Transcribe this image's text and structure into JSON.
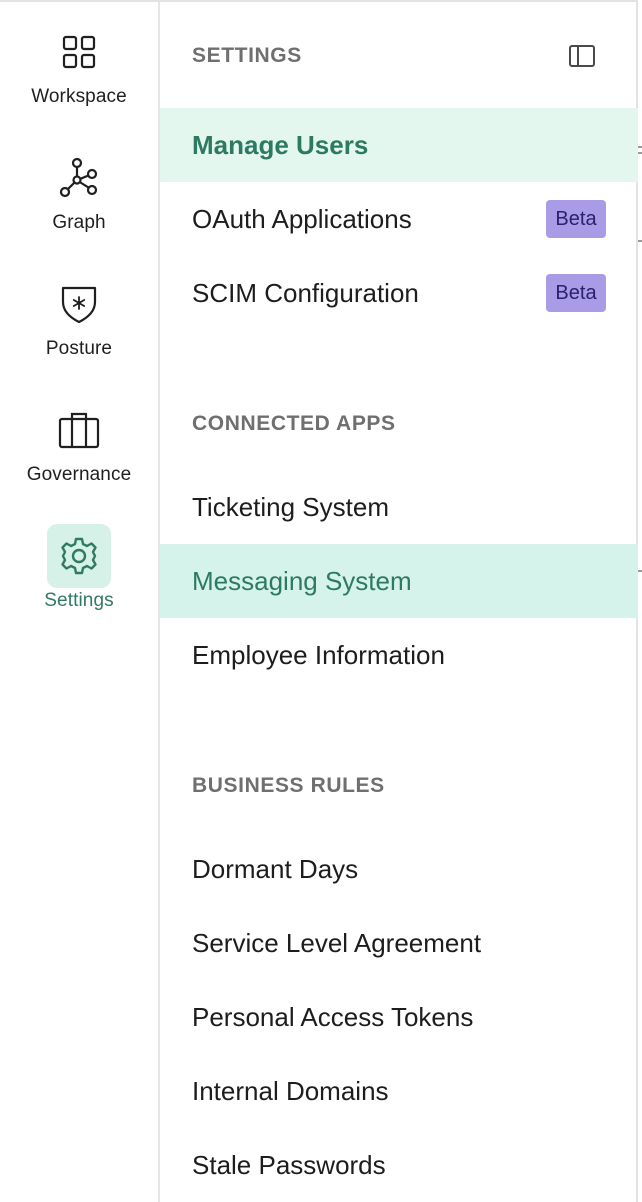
{
  "rail": {
    "items": [
      {
        "label": "Workspace",
        "icon": "grid-icon",
        "active": false
      },
      {
        "label": "Graph",
        "icon": "graph-icon",
        "active": false
      },
      {
        "label": "Posture",
        "icon": "shield-star-icon",
        "active": false
      },
      {
        "label": "Governance",
        "icon": "briefcase-icon",
        "active": false
      },
      {
        "label": "Settings",
        "icon": "gear-icon",
        "active": true
      }
    ]
  },
  "panel": {
    "sections": [
      {
        "title": "SETTINGS",
        "items": [
          {
            "label": "Manage Users",
            "state": "selected"
          },
          {
            "label": "OAuth Applications",
            "badge": "Beta"
          },
          {
            "label": "SCIM Configuration",
            "badge": "Beta"
          }
        ]
      },
      {
        "title": "CONNECTED APPS",
        "items": [
          {
            "label": "Ticketing System"
          },
          {
            "label": "Messaging System",
            "state": "hover"
          },
          {
            "label": "Employee Information"
          }
        ]
      },
      {
        "title": "BUSINESS RULES",
        "items": [
          {
            "label": "Dormant Days"
          },
          {
            "label": "Service Level Agreement"
          },
          {
            "label": "Personal Access Tokens"
          },
          {
            "label": "Internal Domains"
          },
          {
            "label": "Stale Passwords"
          }
        ]
      }
    ]
  },
  "colors": {
    "accent": "#2d7a62",
    "selected_bg": "#e4f7ef",
    "hover_bg": "#d5f3ea",
    "badge_bg": "#a99be6",
    "badge_text": "#2a2070"
  }
}
